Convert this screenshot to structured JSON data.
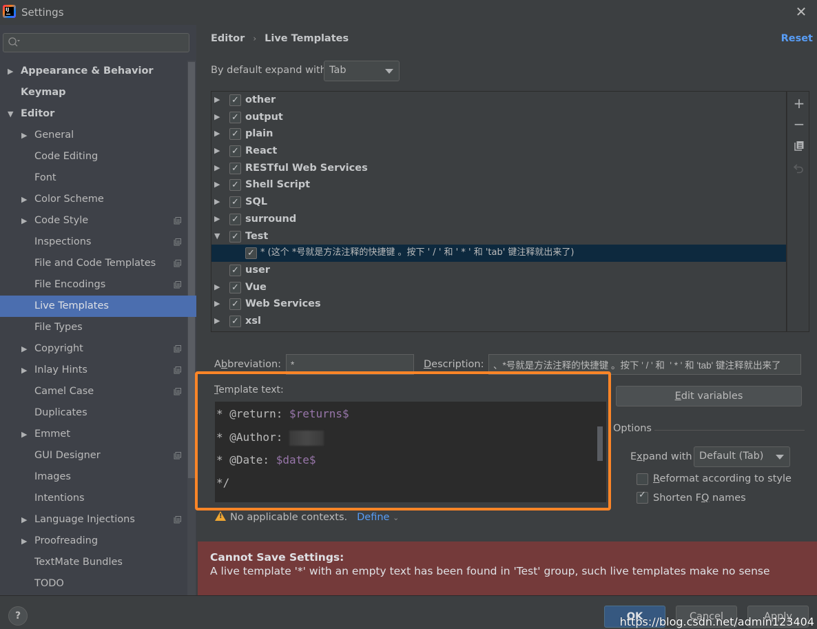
{
  "window": {
    "title": "Settings",
    "close_icon": "close-icon"
  },
  "sidebar": {
    "search": {
      "value": "",
      "placeholder": ""
    },
    "items": [
      {
        "label": "Appearance & Behavior",
        "level": 0,
        "arrow": "▶",
        "project": false
      },
      {
        "label": "Keymap",
        "level": 0,
        "arrow": "",
        "project": false
      },
      {
        "label": "Editor",
        "level": 0,
        "arrow": "▼",
        "project": false
      },
      {
        "label": "General",
        "level": 1,
        "arrow": "▶",
        "project": false
      },
      {
        "label": "Code Editing",
        "level": 1,
        "arrow": "",
        "project": false
      },
      {
        "label": "Font",
        "level": 1,
        "arrow": "",
        "project": false
      },
      {
        "label": "Color Scheme",
        "level": 1,
        "arrow": "▶",
        "project": false
      },
      {
        "label": "Code Style",
        "level": 1,
        "arrow": "▶",
        "project": true
      },
      {
        "label": "Inspections",
        "level": 1,
        "arrow": "",
        "project": true
      },
      {
        "label": "File and Code Templates",
        "level": 1,
        "arrow": "",
        "project": true
      },
      {
        "label": "File Encodings",
        "level": 1,
        "arrow": "",
        "project": true
      },
      {
        "label": "Live Templates",
        "level": 1,
        "arrow": "",
        "project": false,
        "selected": true
      },
      {
        "label": "File Types",
        "level": 1,
        "arrow": "",
        "project": false
      },
      {
        "label": "Copyright",
        "level": 1,
        "arrow": "▶",
        "project": true
      },
      {
        "label": "Inlay Hints",
        "level": 1,
        "arrow": "▶",
        "project": true
      },
      {
        "label": "Camel Case",
        "level": 1,
        "arrow": "",
        "project": true
      },
      {
        "label": "Duplicates",
        "level": 1,
        "arrow": "",
        "project": false
      },
      {
        "label": "Emmet",
        "level": 1,
        "arrow": "▶",
        "project": false
      },
      {
        "label": "GUI Designer",
        "level": 1,
        "arrow": "",
        "project": true
      },
      {
        "label": "Images",
        "level": 1,
        "arrow": "",
        "project": false
      },
      {
        "label": "Intentions",
        "level": 1,
        "arrow": "",
        "project": false
      },
      {
        "label": "Language Injections",
        "level": 1,
        "arrow": "▶",
        "project": true
      },
      {
        "label": "Proofreading",
        "level": 1,
        "arrow": "▶",
        "project": false
      },
      {
        "label": "TextMate Bundles",
        "level": 1,
        "arrow": "",
        "project": false
      },
      {
        "label": "TODO",
        "level": 1,
        "arrow": "",
        "project": false
      }
    ]
  },
  "header": {
    "breadcrumb": [
      "Editor",
      "Live Templates"
    ],
    "breadcrumb_sep": "›",
    "reset_label": "Reset"
  },
  "expand": {
    "label": "By default expand with",
    "value": "Tab"
  },
  "templates": [
    {
      "name": "other",
      "arrow": "▶",
      "checked": true
    },
    {
      "name": "output",
      "arrow": "▶",
      "checked": true
    },
    {
      "name": "plain",
      "arrow": "▶",
      "checked": true
    },
    {
      "name": "React",
      "arrow": "▶",
      "checked": true
    },
    {
      "name": "RESTful Web Services",
      "arrow": "▶",
      "checked": true
    },
    {
      "name": "Shell Script",
      "arrow": "▶",
      "checked": true
    },
    {
      "name": "SQL",
      "arrow": "▶",
      "checked": true
    },
    {
      "name": "surround",
      "arrow": "▶",
      "checked": true
    },
    {
      "name": "Test",
      "arrow": "▼",
      "checked": true
    },
    {
      "name": "* (这个 *号就是方法注释的快捷键 。按下 ' / ' 和  ' * ' 和 'tab' 键注释就出来了)",
      "arrow": "",
      "checked": true,
      "child": true,
      "selected": true
    },
    {
      "name": "user",
      "arrow": "",
      "checked": true
    },
    {
      "name": "Vue",
      "arrow": "▶",
      "checked": true
    },
    {
      "name": "Web Services",
      "arrow": "▶",
      "checked": true
    },
    {
      "name": "xsl",
      "arrow": "▶",
      "checked": true
    }
  ],
  "list_tools": {
    "add": "+",
    "remove": "−",
    "copy": "copy-icon",
    "restore": "restore-icon"
  },
  "abbreviation": {
    "label_pre": "A",
    "label_u": "b",
    "label_post": "breviation:",
    "value": "*"
  },
  "description": {
    "label_u": "D",
    "label_post": "escription:",
    "value": "、*号就是方法注释的快捷键 。按下 ' / ' 和  ' * ' 和 'tab' 键注释就出来了"
  },
  "template_text": {
    "label_u": "T",
    "label_post": "emplate text:",
    "lines": [
      {
        "prefix": "* @return: ",
        "var": "$returns$"
      },
      {
        "prefix": "* @Author: ",
        "var": ""
      },
      {
        "prefix": "* @Date: ",
        "var": "$date$"
      },
      {
        "prefix": "*/",
        "var": ""
      }
    ]
  },
  "edit_variables": {
    "label_u": "E",
    "label_post": "dit variables"
  },
  "options": {
    "title": "Options",
    "expand_label_pre": "E",
    "expand_label_u": "x",
    "expand_label_post": "pand with",
    "expand_value": "Default (Tab)",
    "reformat": {
      "label_u": "R",
      "label_post": "eformat according to style",
      "checked": false
    },
    "shorten": {
      "label_pre": "Shorten F",
      "label_u": "Q",
      "label_post": " names",
      "checked": true
    }
  },
  "warning": {
    "text": "No applicable contexts.",
    "define_label": "Define",
    "chevron": "⌄"
  },
  "error": {
    "title": "Cannot Save Settings:",
    "message": "A live template '*' with an empty text has been found in 'Test' group, such live templates make no sense",
    "color": "#743a3a"
  },
  "footer": {
    "help": "?",
    "ok": "OK",
    "cancel": "Cancel",
    "apply": "Apply",
    "watermark": "https://blog.csdn.net/admin123404"
  },
  "colors": {
    "accent": "#4b6eaf",
    "link": "#589df6",
    "highlight_frame": "#fc8527",
    "template_var": "#9876aa"
  }
}
